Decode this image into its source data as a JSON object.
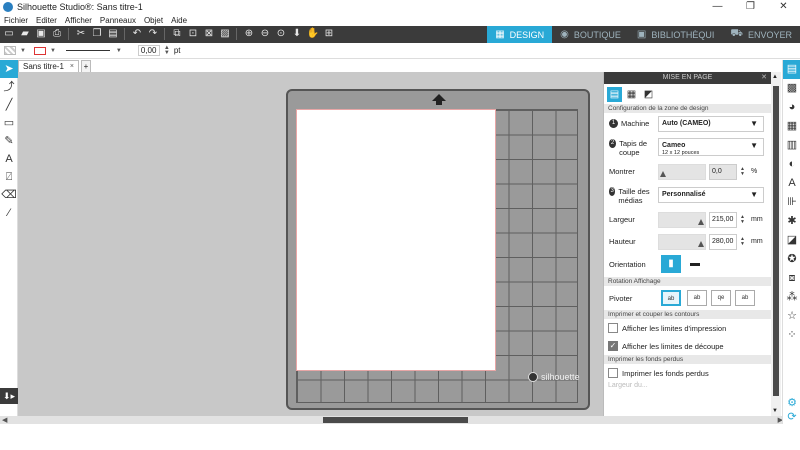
{
  "window": {
    "title": "Silhouette Studio®: Sans titre-1",
    "controls": [
      "—",
      "❐",
      "✕"
    ]
  },
  "menu": [
    "Fichier",
    "Editer",
    "Afficher",
    "Panneaux",
    "Objet",
    "Aide"
  ],
  "toolbar": {
    "icons": [
      "new-file",
      "open-folder",
      "save",
      "print",
      "cut",
      "copy",
      "paste",
      "undo",
      "redo",
      "group",
      "ungroup",
      "select-all",
      "deselect",
      "zoom-in",
      "zoom-out",
      "zoom-fit",
      "move-down",
      "pan",
      "zoom-page"
    ],
    "nav_tabs": [
      {
        "label": "DESIGN",
        "icon": "▦",
        "active": true
      },
      {
        "label": "BOUTIQUE",
        "icon": "◉",
        "active": false
      },
      {
        "label": "BIBLIOTHÈQUI",
        "icon": "▣",
        "active": false
      },
      {
        "label": "ENVOYER",
        "icon": "⛟",
        "active": false
      }
    ]
  },
  "toolbar2": {
    "line_width": "0,00",
    "unit": "pt"
  },
  "doc_tabs": {
    "active": "Sans titre-1",
    "close": "×",
    "add": "+"
  },
  "left_tools": [
    "select",
    "point-edit",
    "line",
    "rectangle",
    "pencil",
    "text",
    "eraser-knife",
    "eraser",
    "eyedropper"
  ],
  "mat": {
    "brand": "silhouette"
  },
  "panel": {
    "title": "MISE EN PAGE",
    "close": "✕",
    "section_design": "Configuration de la zone de design",
    "machine_label": "Machine",
    "machine_value": "Auto (CAMEO)",
    "mat_label": "Tapis de coupe",
    "mat_value": "Cameo",
    "mat_sub": "12 x 12 pouces",
    "show_label": "Montrer",
    "show_value": "0,0",
    "show_unit": "%",
    "media_label": "Taille des médias",
    "media_value": "Personnalisé",
    "width_label": "Largeur",
    "width_value": "215,00",
    "width_unit": "mm",
    "height_label": "Hauteur",
    "height_value": "280,00",
    "height_unit": "mm",
    "orientation_label": "Orientation",
    "section_rotation": "Rotation Affichage",
    "rotate_label": "Pivoter",
    "section_print": "Imprimer et couper les contours",
    "print_limits": "Afficher les limites d'impression",
    "cut_limits": "Afficher les limites de découpe",
    "cut_limits_checked": true,
    "print_limits_checked": false,
    "section_bleed": "Imprimer les fonds perdus",
    "bleed_label": "Imprimer les fonds perdus",
    "bleed_checked": false,
    "faded_label": "Largeur du..."
  },
  "right_strip": [
    "page-setup",
    "pixscan",
    "fill-color",
    "line-color",
    "fill-gradient",
    "contrast",
    "text-style",
    "align",
    "replicate",
    "transform",
    "offset",
    "trace",
    "modify",
    "sketch",
    "favorites"
  ],
  "colors": {
    "accent": "#29a9d6",
    "toolbar": "#3b3b3b",
    "canvas": "#c8c8c8",
    "mat": "#9a9a9a"
  }
}
